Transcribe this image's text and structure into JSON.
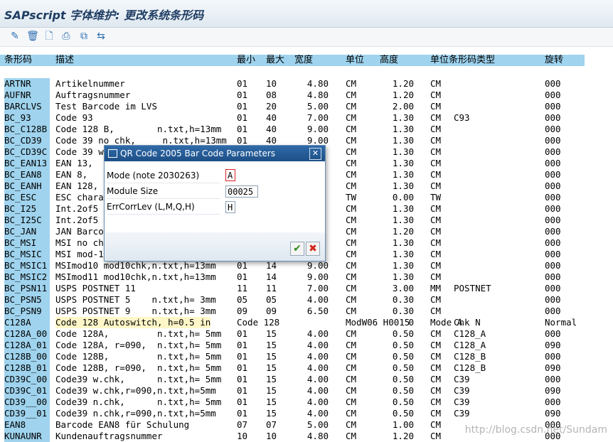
{
  "window": {
    "title": "SAPscript 字体维护: 更改系统条形码"
  },
  "toolbar": {
    "icons": [
      "pencil-icon",
      "trash-icon",
      "new-document-icon",
      "print-icon",
      "copy-icon",
      "move-icon"
    ],
    "glyphs": [
      "✎",
      "🗑",
      "🗋",
      "⎙",
      "⧉",
      "⇆"
    ]
  },
  "table": {
    "headers": [
      "条形码",
      "描述",
      "最小",
      "最大",
      "宽度",
      "单位",
      "高度",
      "单位条形码类型",
      "旋转"
    ],
    "rows": [
      [
        "ARTNR",
        "Artikelnummer",
        "01",
        "10",
        "4.80",
        "CM",
        "1.20",
        "CM",
        "",
        "000"
      ],
      [
        "AUFNR",
        "Auftragsnummer",
        "01",
        "08",
        "4.80",
        "CM",
        "1.20",
        "CM",
        "",
        "000"
      ],
      [
        "BARCLVS",
        "Test Barcode im LVS",
        "01",
        "20",
        "5.00",
        "CM",
        "2.00",
        "CM",
        "",
        "000"
      ],
      [
        "BC_93",
        "Code 93",
        "01",
        "40",
        "7.00",
        "CM",
        "1.30",
        "CM",
        "C93",
        "000"
      ],
      [
        "BC_C128B",
        "Code 128 B,        n.txt,h=13mm",
        "01",
        "40",
        "9.00",
        "CM",
        "1.30",
        "CM",
        "",
        "000"
      ],
      [
        "BC_CD39",
        "Code 39 no chk,     n.txt,h=13mm",
        "01",
        "40",
        "9.00",
        "CM",
        "1.30",
        "CM",
        "",
        "000"
      ],
      [
        "BC_CD39C",
        "Code 39 w",
        "",
        "",
        "",
        "CM",
        "1.30",
        "CM",
        "",
        "000"
      ],
      [
        "BC_EAN13",
        "EAN 13,",
        "",
        "",
        "",
        "CM",
        "1.30",
        "CM",
        "",
        "000"
      ],
      [
        "BC_EAN8",
        "EAN 8,",
        "",
        "",
        "",
        "CM",
        "1.30",
        "CM",
        "",
        "000"
      ],
      [
        "BC_EANH",
        "EAN 128,",
        "",
        "",
        "",
        "CM",
        "1.30",
        "CM",
        "",
        "000"
      ],
      [
        "BC_ESC",
        "ESC chara",
        "",
        "",
        "",
        "TW",
        "0.00",
        "TW",
        "",
        "000"
      ],
      [
        "BC_I25",
        "Int.2of5",
        "",
        "",
        "",
        "CM",
        "1.30",
        "CM",
        "",
        "000"
      ],
      [
        "BC_I25C",
        "Int.2of5",
        "",
        "",
        "",
        "CM",
        "1.30",
        "CM",
        "",
        "000"
      ],
      [
        "BC_JAN",
        "JAN Barco",
        "",
        "",
        "",
        "CM",
        "1.20",
        "CM",
        "",
        "000"
      ],
      [
        "BC_MSI",
        "MSI no ch",
        "",
        "",
        "",
        "CM",
        "1.30",
        "CM",
        "",
        "000"
      ],
      [
        "BC_MSIC",
        "MSI mod-1",
        "",
        "",
        "",
        "CM",
        "1.30",
        "CM",
        "",
        "000"
      ],
      [
        "BC_MSIC1",
        "MSImod10 mod10chk,n.txt,h=13mm",
        "01",
        "14",
        "9.00",
        "CM",
        "1.30",
        "CM",
        "",
        "000"
      ],
      [
        "BC_MSIC2",
        "MSImod11 mod10chk,n.txt,h=13mm",
        "01",
        "14",
        "9.00",
        "CM",
        "1.30",
        "CM",
        "",
        "000"
      ],
      [
        "BC_PSN11",
        "USPS POSTNET 11",
        "11",
        "11",
        "7.00",
        "CM",
        "3.00",
        "MM",
        "POSTNET",
        "000"
      ],
      [
        "BC_PSN5",
        "USPS POSTNET 5    n.txt,h= 3mm",
        "05",
        "05",
        "4.00",
        "CM",
        "0.30",
        "CM",
        "",
        "000"
      ],
      [
        "BC_PSN9",
        "USPS POSTNET 9    n.txt,h= 3mm",
        "09",
        "09",
        "6.50",
        "CM",
        "0.30",
        "CM",
        "",
        "000"
      ],
      [
        "C128A",
        "Code 128 Autoswitch, h=0.5 in",
        "Code 128",
        "",
        "",
        "ModW06 H0015",
        "0",
        "Mode A",
        "Chk N",
        "Normal"
      ],
      [
        "C128A_00",
        "Code 128A,         n.txt,h= 5mm",
        "01",
        "15",
        "4.00",
        "CM",
        "0.50",
        "CM",
        "C128_A",
        "000"
      ],
      [
        "C128A_01",
        "Code 128A, r=090,  n.txt,h= 5mm",
        "01",
        "15",
        "4.00",
        "CM",
        "0.50",
        "CM",
        "C128_A",
        "090"
      ],
      [
        "C128B_00",
        "Code 128B,         n.txt,h= 5mm",
        "01",
        "15",
        "4.00",
        "CM",
        "0.50",
        "CM",
        "C128_B",
        "000"
      ],
      [
        "C128B_01",
        "Code 128B, r=090,  n.txt,h= 5mm",
        "01",
        "15",
        "4.00",
        "CM",
        "0.50",
        "CM",
        "C128_B",
        "090"
      ],
      [
        "CD39C_00",
        "Code39 w.chk,      n.txt,h= 5mm",
        "01",
        "15",
        "4.00",
        "CM",
        "0.50",
        "CM",
        "C39",
        "000"
      ],
      [
        "CD39C_01",
        "Code39 w.chk,r=090,n.txt,h=5mm",
        "01",
        "15",
        "4.00",
        "CM",
        "0.50",
        "CM",
        "C39",
        "090"
      ],
      [
        "CD39__00",
        "Code39 n.chk,      n.txt,h= 5mm",
        "01",
        "15",
        "4.00",
        "CM",
        "0.50",
        "CM",
        "C39",
        "000"
      ],
      [
        "CD39__01",
        "Code39 n.chk,r=090,n.txt,h=5mm",
        "01",
        "15",
        "4.00",
        "CM",
        "0.50",
        "CM",
        "C39",
        "090"
      ],
      [
        "EAN8",
        "Barcode EAN8 für Schulung",
        "07",
        "07",
        "5.00",
        "CM",
        "1.00",
        "CM",
        "",
        "000"
      ],
      [
        "KUNAUNR",
        "Kundenauftragsnummer",
        "10",
        "10",
        "4.80",
        "CM",
        "1.20",
        "CM",
        "",
        "000"
      ]
    ]
  },
  "dialog": {
    "title": "QR Code 2005 Bar Code Parameters",
    "fields": [
      {
        "label": "Mode (note 2030263)",
        "value": "A"
      },
      {
        "label": "Module Size",
        "value": "00025"
      },
      {
        "label": "ErrCorrLev (L,M,Q,H)",
        "value": "H"
      }
    ],
    "ok_glyph": "✔",
    "cancel_glyph": "✖",
    "close_glyph": "✕"
  },
  "watermark": "http://blog.csdn.net/Sundam"
}
